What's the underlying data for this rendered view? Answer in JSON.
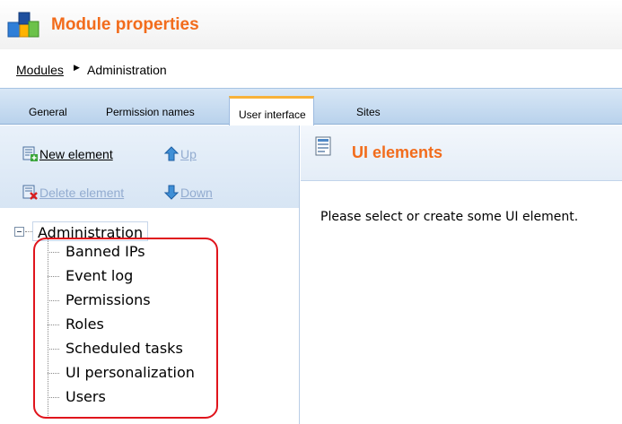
{
  "header": {
    "title": "Module properties",
    "icon": "module-blocks-icon",
    "title_color": "#f26c1c"
  },
  "breadcrumb": {
    "link": "Modules",
    "separator": "▶",
    "current": "Administration"
  },
  "tabs": [
    {
      "label": "General",
      "active": false
    },
    {
      "label": "Permission names",
      "active": false
    },
    {
      "label": "User interface",
      "active": true
    },
    {
      "label": "Sites",
      "active": false
    }
  ],
  "toolbar": {
    "new_element": "New element",
    "up": "Up",
    "delete_element": "Delete element",
    "down": "Down"
  },
  "tree": {
    "root": "Administration",
    "children": [
      "Banned IPs",
      "Event log",
      "Permissions",
      "Roles",
      "Scheduled tasks",
      "UI personalization",
      "Users"
    ]
  },
  "content": {
    "title": "UI elements",
    "message": "Please select or create some UI element."
  },
  "colors": {
    "accent": "#f26c1c",
    "tab_bar": "#c5daf0",
    "highlight": "#e0141c",
    "disabled_text": "#93acd0"
  }
}
